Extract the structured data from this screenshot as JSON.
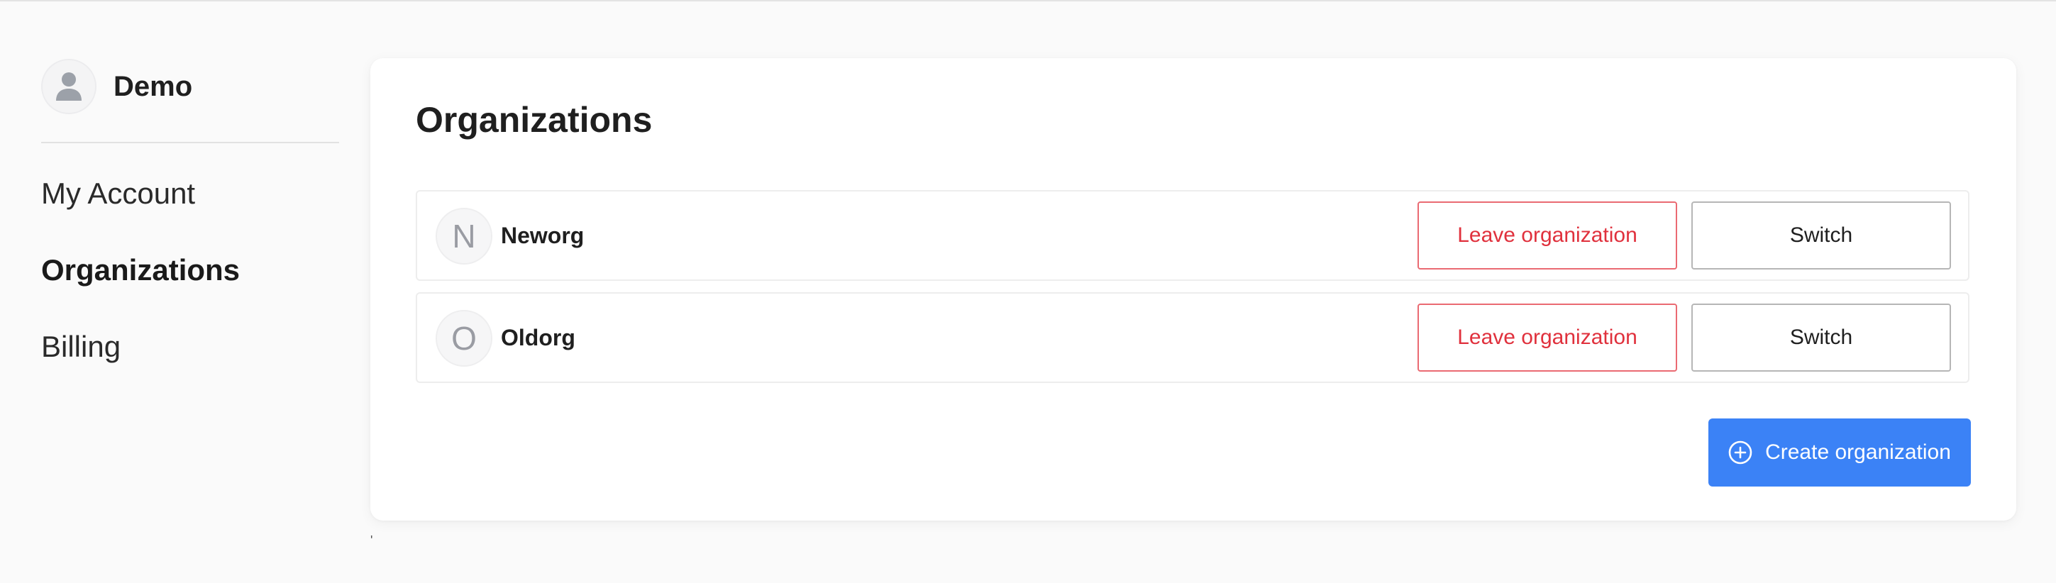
{
  "profile": {
    "name": "Demo",
    "avatar_icon": "user-icon"
  },
  "sidebar": {
    "items": [
      {
        "label": "My Account",
        "active": false
      },
      {
        "label": "Organizations",
        "active": true
      },
      {
        "label": "Billing",
        "active": false
      }
    ]
  },
  "main": {
    "title": "Organizations",
    "organizations": [
      {
        "initial": "N",
        "name": "Neworg",
        "leave_label": "Leave organization",
        "switch_label": "Switch"
      },
      {
        "initial": "O",
        "name": "Oldorg",
        "leave_label": "Leave organization",
        "switch_label": "Switch"
      }
    ],
    "create_label": "Create organization",
    "create_icon": "plus-circle-icon"
  },
  "colors": {
    "accent": "#3b82f6",
    "danger": "#e0313d",
    "background": "#fafafa"
  },
  "footer_mark": "'"
}
